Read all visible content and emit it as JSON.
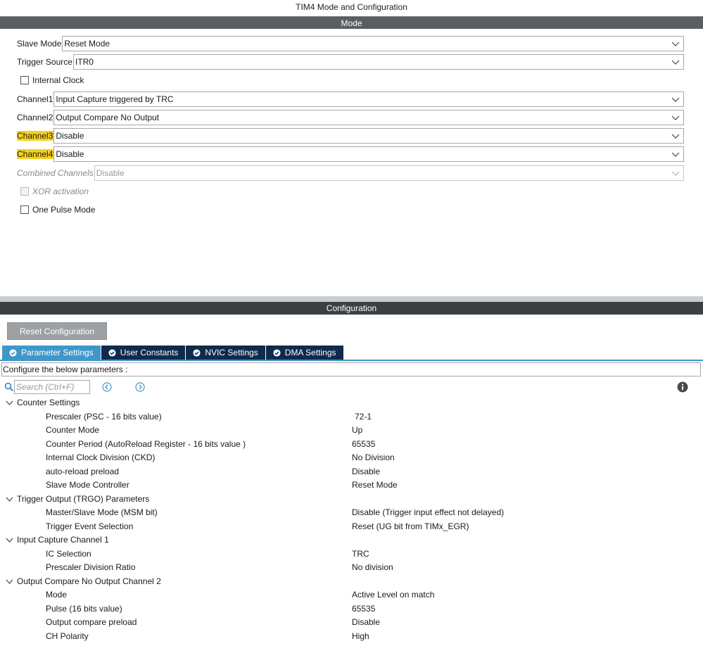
{
  "window": {
    "title": "TIM4 Mode and Configuration"
  },
  "mode": {
    "header": "Mode",
    "slave_mode": {
      "label": "Slave Mode",
      "value": "Reset Mode"
    },
    "trigger_source": {
      "label": "Trigger Source",
      "value": "ITR0"
    },
    "internal_clock": {
      "label": "Internal Clock",
      "checked": false
    },
    "channel1": {
      "label": "Channel1",
      "value": "Input Capture triggered by TRC"
    },
    "channel2": {
      "label": "Channel2",
      "value": "Output Compare No Output"
    },
    "channel3": {
      "label": "Channel3",
      "value": "Disable",
      "highlight": "#f6d11c"
    },
    "channel4": {
      "label": "Channel4",
      "value": "Disable",
      "highlight": "#f6d11c"
    },
    "combined_channels": {
      "label": "Combined Channels",
      "value": "Disable",
      "disabled": true
    },
    "xor_activation": {
      "label": "XOR activation",
      "checked": false,
      "disabled": true
    },
    "one_pulse_mode": {
      "label": "One Pulse Mode",
      "checked": false
    }
  },
  "configuration": {
    "header": "Configuration",
    "reset_button": "Reset Configuration",
    "tabs": [
      {
        "label": "Parameter Settings",
        "icon": "check-circle-icon",
        "active": true
      },
      {
        "label": "User Constants",
        "icon": "check-circle-icon",
        "active": false
      },
      {
        "label": "NVIC Settings",
        "icon": "check-circle-icon",
        "active": false
      },
      {
        "label": "DMA Settings",
        "icon": "check-circle-icon",
        "active": false
      }
    ],
    "description": "Configure the below parameters :",
    "search": {
      "placeholder": "Search (Ctrl+F)",
      "value": ""
    },
    "groups": [
      {
        "name": "Counter Settings",
        "params": [
          {
            "name": "Prescaler (PSC - 16 bits value)",
            "value": "72-1"
          },
          {
            "name": "Counter Mode",
            "value": "Up"
          },
          {
            "name": "Counter Period (AutoReload Register - 16 bits value )",
            "value": "65535"
          },
          {
            "name": "Internal Clock Division (CKD)",
            "value": "No Division"
          },
          {
            "name": "auto-reload preload",
            "value": "Disable"
          },
          {
            "name": "Slave Mode Controller",
            "value": "Reset Mode"
          }
        ]
      },
      {
        "name": "Trigger Output (TRGO) Parameters",
        "params": [
          {
            "name": "Master/Slave Mode (MSM bit)",
            "value": "Disable (Trigger input effect not delayed)"
          },
          {
            "name": "Trigger Event Selection",
            "value": "Reset (UG bit from TIMx_EGR)"
          }
        ]
      },
      {
        "name": "Input Capture Channel 1",
        "params": [
          {
            "name": "IC Selection",
            "value": "TRC"
          },
          {
            "name": "Prescaler Division Ratio",
            "value": "No division"
          }
        ]
      },
      {
        "name": "Output Compare No Output Channel 2",
        "params": [
          {
            "name": "Mode",
            "value": "Active Level on match"
          },
          {
            "name": "Pulse (16 bits value)",
            "value": "65535"
          },
          {
            "name": "Output compare preload",
            "value": "Disable"
          },
          {
            "name": "CH Polarity",
            "value": "High"
          }
        ]
      }
    ]
  },
  "colors": {
    "mode_header": "#5a5e61",
    "config_header": "#3c4043",
    "tab_active": "#3f97c9",
    "tab_inactive": "#0f2a4a",
    "highlight": "#f6d11c"
  }
}
